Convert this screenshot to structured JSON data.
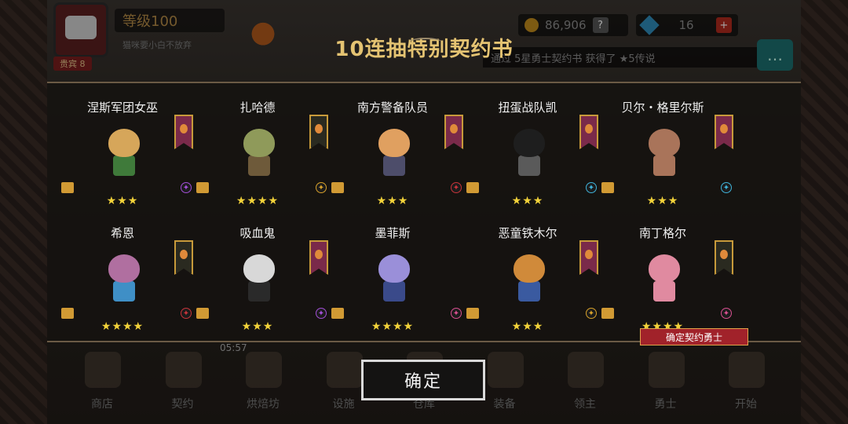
{
  "header": {
    "level": "等级100",
    "guild_name": "猫咪要小白不放弃",
    "vip": "贵宾 8",
    "gold": "86,906",
    "gold_help": "?",
    "gems": "16",
    "gems_plus": "+",
    "ticker": "通过 5星勇士契约书 获得了 ★5传说",
    "chat_icon": "chat-bubble-icon"
  },
  "panel": {
    "title": "10连抽特别契约书"
  },
  "heroes": [
    {
      "name": "涅斯军团女巫",
      "stars": "★★★",
      "banner": "normal",
      "weapon_color": "#a34fd8",
      "sprite_head": "#d6a65a",
      "sprite_body": "#3f7a3a"
    },
    {
      "name": "扎哈德",
      "stars": "★★★★",
      "banner": "dark",
      "weapon_color": "#d8a12a",
      "sprite_head": "#8f9a5a",
      "sprite_body": "#6e5a3a"
    },
    {
      "name": "南方警备队员",
      "stars": "★★★",
      "banner": "normal",
      "weapon_color": "#c8343a",
      "sprite_head": "#e0a060",
      "sprite_body": "#4d4d6a"
    },
    {
      "name": "扭蛋战队凯",
      "stars": "★★★",
      "banner": "normal",
      "weapon_color": "#3fb2d9",
      "sprite_head": "#1e1e1e",
      "sprite_body": "#5a5a5a"
    },
    {
      "name": "贝尔・格里尔斯",
      "stars": "★★★",
      "banner": "normal",
      "weapon_color": "#3fb2d9",
      "sprite_head": "#a9745a",
      "sprite_body": "#a9745a"
    },
    {
      "name": "希恩",
      "stars": "★★★★",
      "banner": "dark",
      "weapon_color": "#c8343a",
      "sprite_head": "#b06fa0",
      "sprite_body": "#3f8fc6"
    },
    {
      "name": "吸血鬼",
      "stars": "★★★",
      "banner": "normal",
      "weapon_color": "#a34fd8",
      "sprite_head": "#d8d8d8",
      "sprite_body": "#2a2a2a"
    },
    {
      "name": "墨菲斯",
      "stars": "★★★★",
      "banner": "none",
      "weapon_color": "#d84f8f",
      "sprite_head": "#9a8fd9",
      "sprite_body": "#3a4a8a"
    },
    {
      "name": "恶童铁木尔",
      "stars": "★★★",
      "banner": "normal",
      "weapon_color": "#d8a12a",
      "sprite_head": "#d08a3a",
      "sprite_body": "#3a5aa0"
    },
    {
      "name": "南丁格尔",
      "stars": "★★★★",
      "banner": "dark",
      "weapon_color": "#d84f8f",
      "sprite_head": "#e08aa0",
      "sprite_body": "#e08aa0"
    }
  ],
  "confirm_tag": "确定契约勇士",
  "confirm_button": "确定",
  "bottom_nav": [
    {
      "label": "商店",
      "icon": "shop-icon"
    },
    {
      "label": "契约",
      "icon": "contract-icon"
    },
    {
      "label": "烘焙坊",
      "icon": "bakery-icon"
    },
    {
      "label": "设施",
      "icon": "facility-icon"
    },
    {
      "label": "仓库",
      "icon": "warehouse-icon"
    },
    {
      "label": "装备",
      "icon": "equipment-icon"
    },
    {
      "label": "领主",
      "icon": "lord-icon"
    },
    {
      "label": "勇士",
      "icon": "warrior-icon"
    },
    {
      "label": "开始",
      "icon": "start-icon"
    }
  ],
  "timer": "05:57"
}
